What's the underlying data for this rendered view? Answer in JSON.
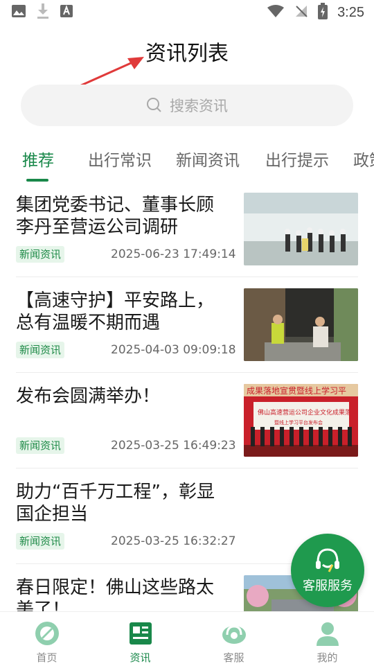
{
  "status_bar": {
    "time": "3:25"
  },
  "header": {
    "title": "资讯列表"
  },
  "search": {
    "placeholder": "搜索资讯"
  },
  "tabs": [
    {
      "label": "推荐",
      "active": true
    },
    {
      "label": "出行常识"
    },
    {
      "label": "新闻资讯"
    },
    {
      "label": "出行提示"
    },
    {
      "label": "政策"
    }
  ],
  "news": [
    {
      "title": "集团党委书记、董事长顾李丹至营运公司调研",
      "tag": "新闻资讯",
      "date": "2025-06-23 17:49:14"
    },
    {
      "title": "【高速守护】平安路上，总有温暖不期而遇",
      "tag": "新闻资讯",
      "date": "2025-04-03 09:09:18"
    },
    {
      "title": "发布会圆满举办！",
      "tag": "新闻资讯",
      "date": "2025-03-25 16:49:23",
      "thumb_text": {
        "top": "成果落地宣贯暨线上学习平",
        "main": "佛山高速营运公司企业文化成果落地宣贯",
        "sub": "暨线上学习平台发布会"
      }
    },
    {
      "title": "助力“百千万工程”，彰显国企担当",
      "tag": "新闻资讯",
      "date": "2025-03-25 16:32:27"
    },
    {
      "title": "春日限定！佛山这些路太美了！",
      "tag": "",
      "date": ""
    }
  ],
  "fab": {
    "label": "客服服务"
  },
  "bottom_nav": [
    {
      "label": "首页"
    },
    {
      "label": "资讯",
      "active": true
    },
    {
      "label": "客服"
    },
    {
      "label": "我的"
    }
  ],
  "colors": {
    "accent": "#19884a",
    "tag_bg": "#e6f5ea",
    "fab": "#1f9a4e"
  }
}
